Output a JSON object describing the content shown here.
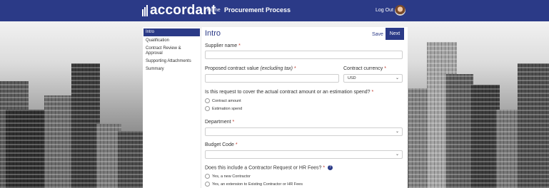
{
  "header": {
    "logo_text": "accordant",
    "home_label": "Home",
    "title": "Procurement Process",
    "logout_label": "Log Out"
  },
  "sidebar": {
    "items": [
      {
        "label": "Intro"
      },
      {
        "label": "Qualification"
      },
      {
        "label": "Contract Review & Approval"
      },
      {
        "label": "Supporting Attachments"
      },
      {
        "label": "Summary"
      }
    ]
  },
  "form": {
    "title": "Intro",
    "save_label": "Save",
    "next_label": "Next",
    "supplier_name_label": "Supplier name",
    "supplier_name_value": "",
    "contract_value_label": "Proposed contract value",
    "contract_value_hint": "(excluding tax)",
    "contract_value_value": "",
    "currency_label": "Contract currency",
    "currency_value": "USD",
    "estimation_question": "Is this request to cover the actual contract amount or an estimation spend?",
    "estimation_options": [
      "Contract amount",
      "Estimation spend"
    ],
    "department_label": "Department",
    "department_value": "",
    "budget_code_label": "Budget Code",
    "budget_code_value": "",
    "contractor_question": "Does this include a Contractor Request or HR Fees?",
    "contractor_options": [
      "Yes, a new Contractor",
      "Yes, an extension to Existing Contractor or HR Fees"
    ],
    "required_marker": "*",
    "help_glyph": "?",
    "chevron_glyph": "⌄"
  },
  "colors": {
    "brand": "#2b3a87",
    "required": "#c0392b"
  }
}
